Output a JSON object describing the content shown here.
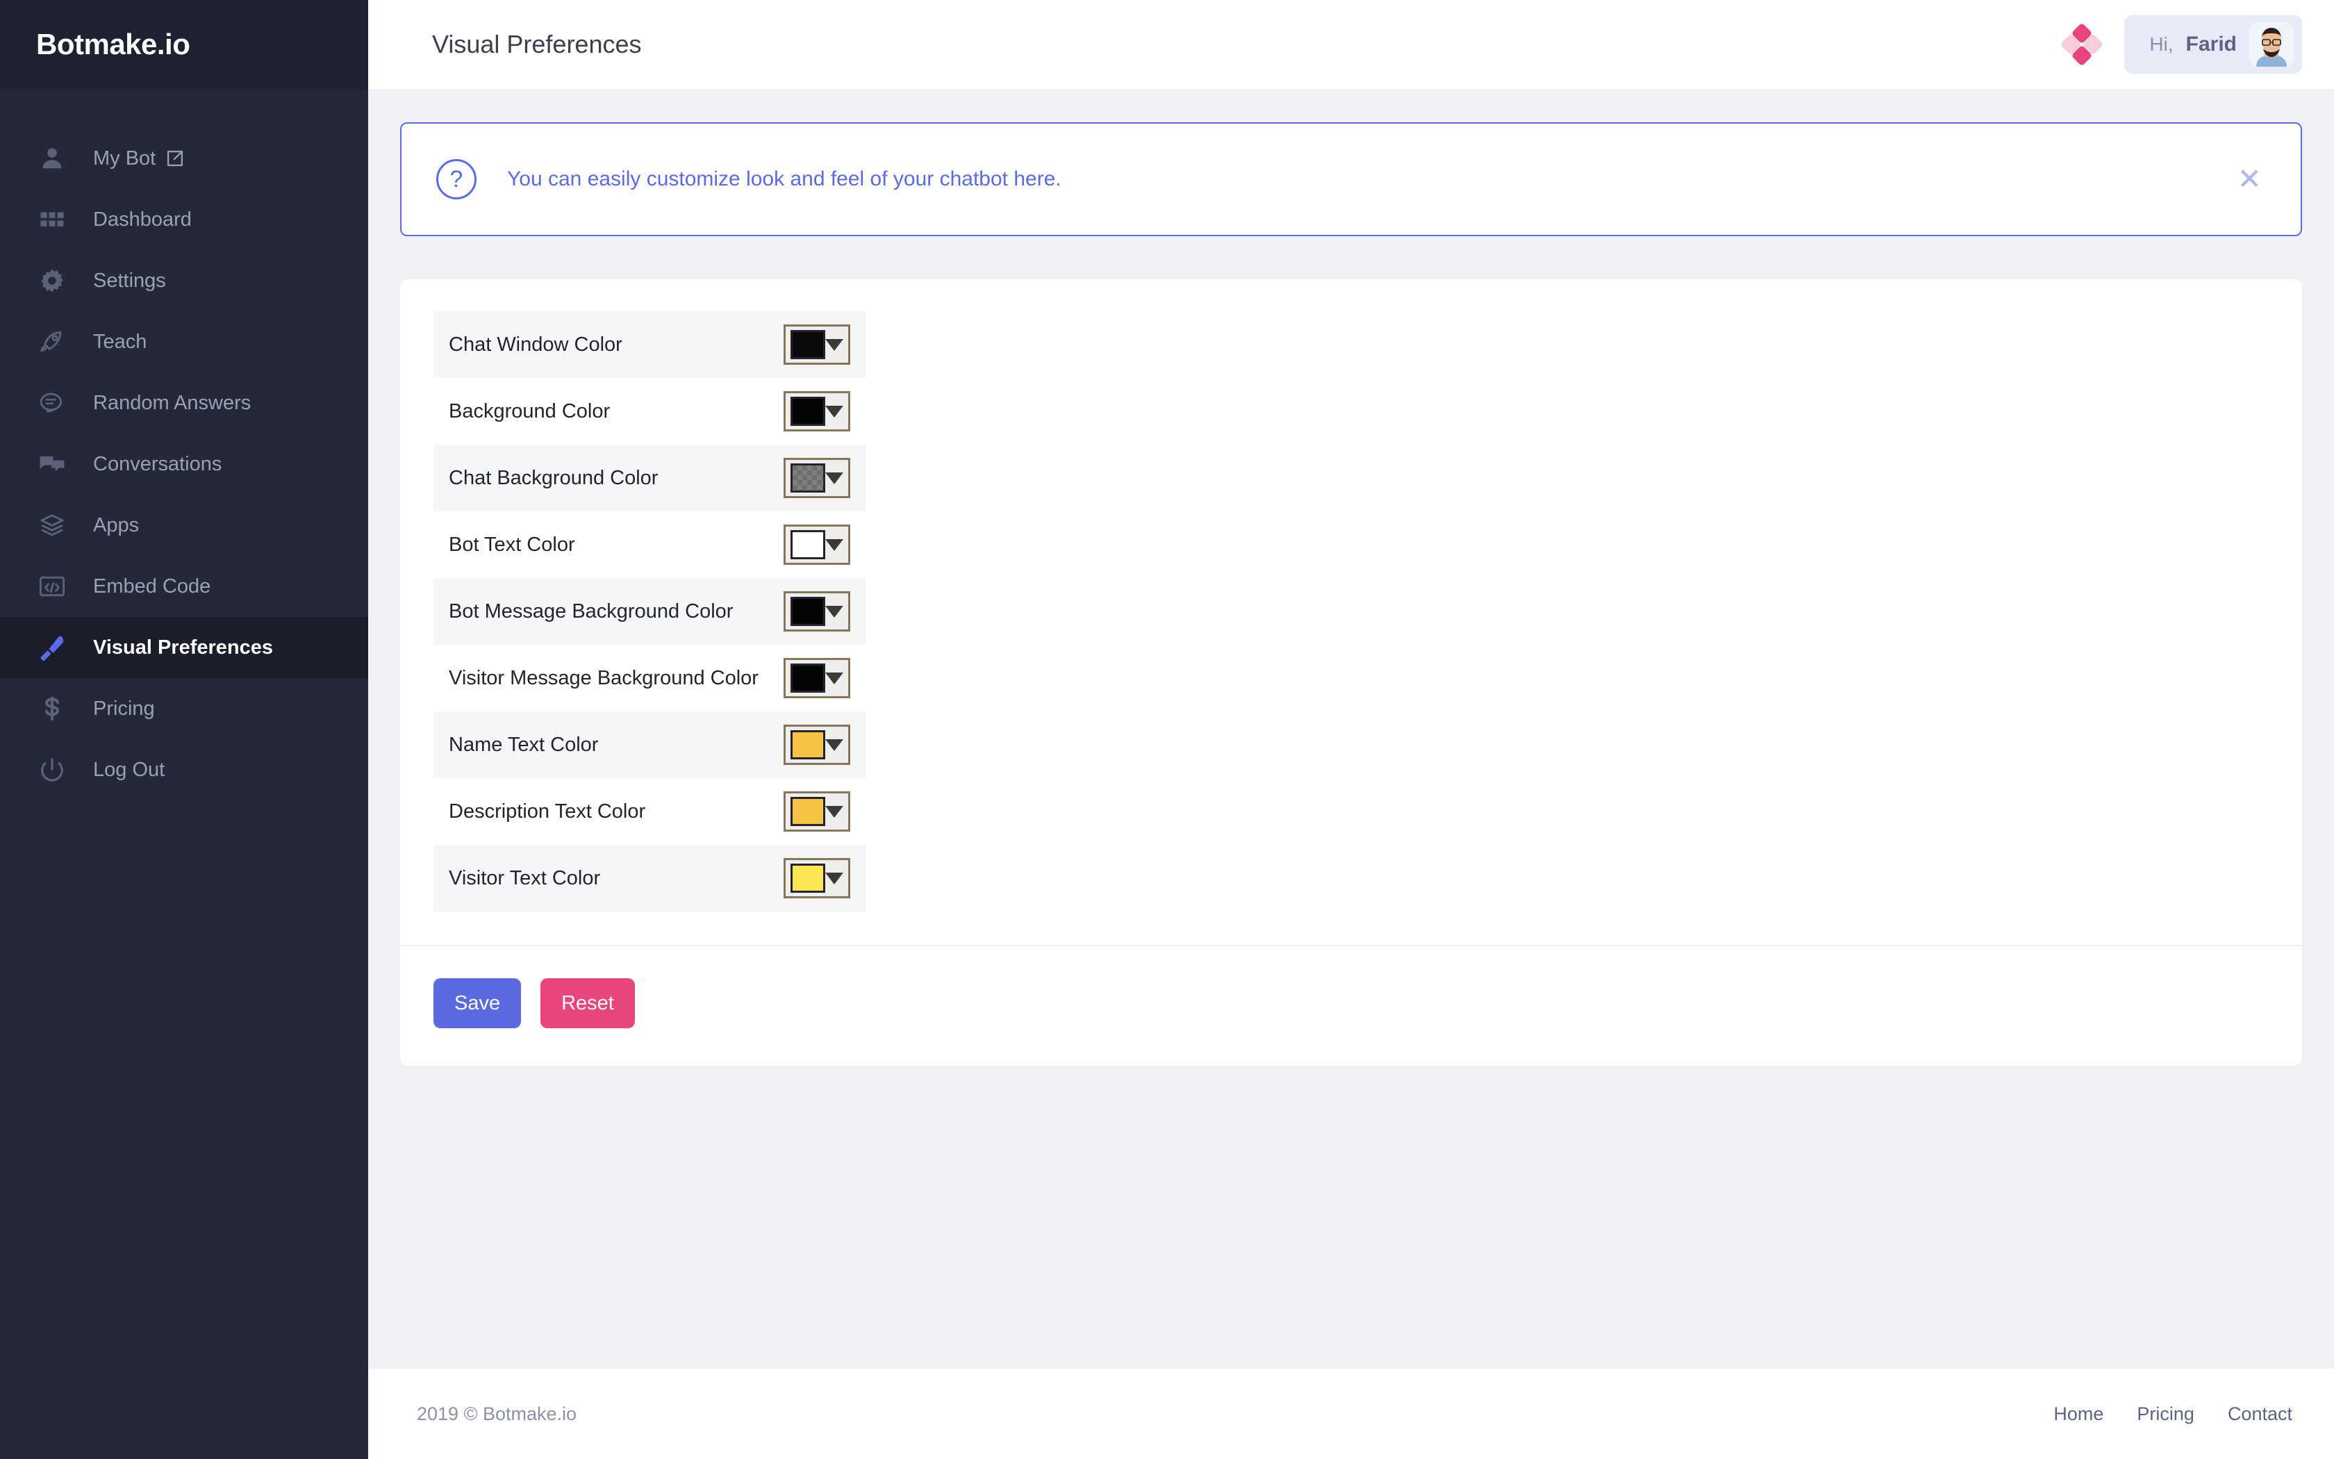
{
  "brand": {
    "name": "Botmake.io"
  },
  "sidebar": {
    "items": [
      {
        "label": "My Bot",
        "icon": "user-icon",
        "external": true,
        "active": false
      },
      {
        "label": "Dashboard",
        "icon": "grid-icon",
        "external": false,
        "active": false
      },
      {
        "label": "Settings",
        "icon": "gear-icon",
        "external": false,
        "active": false
      },
      {
        "label": "Teach",
        "icon": "rocket-icon",
        "external": false,
        "active": false
      },
      {
        "label": "Random Answers",
        "icon": "chat-bubbles-icon",
        "external": false,
        "active": false
      },
      {
        "label": "Conversations",
        "icon": "conversations-icon",
        "external": false,
        "active": false
      },
      {
        "label": "Apps",
        "icon": "layers-icon",
        "external": false,
        "active": false
      },
      {
        "label": "Embed Code",
        "icon": "code-icon",
        "external": false,
        "active": false
      },
      {
        "label": "Visual Preferences",
        "icon": "paintbrush-icon",
        "external": false,
        "active": true
      },
      {
        "label": "Pricing",
        "icon": "dollar-icon",
        "external": false,
        "active": false
      },
      {
        "label": "Log Out",
        "icon": "power-icon",
        "external": false,
        "active": false
      }
    ]
  },
  "header": {
    "title": "Visual Preferences",
    "logo_icon": "diamond-logo-icon",
    "greeting": "Hi,",
    "username": "Farid",
    "avatar_icon": "user-avatar"
  },
  "banner": {
    "icon": "question-mark-icon",
    "message": "You can easily customize look and feel of your chatbot here.",
    "close_icon": "close-icon",
    "accent_color": "#5b6ae8"
  },
  "preferences": {
    "rows": [
      {
        "label": "Chat Window Color",
        "color": "#0a0a0a",
        "transparent": false
      },
      {
        "label": "Background Color",
        "color": "#050505",
        "transparent": false
      },
      {
        "label": "Chat Background Color",
        "color": "#6b6b6b",
        "transparent": true
      },
      {
        "label": "Bot Text Color",
        "color": "#ffffff",
        "transparent": false
      },
      {
        "label": "Bot Message Background Color",
        "color": "#050505",
        "transparent": false
      },
      {
        "label": "Visitor Message Background Color",
        "color": "#050505",
        "transparent": false
      },
      {
        "label": "Name Text Color",
        "color": "#f5c242",
        "transparent": false
      },
      {
        "label": "Description Text Color",
        "color": "#f5c242",
        "transparent": false
      },
      {
        "label": "Visitor Text Color",
        "color": "#fce552",
        "transparent": false
      }
    ]
  },
  "actions": {
    "save_label": "Save",
    "reset_label": "Reset",
    "save_color": "#5b6ae0",
    "reset_color": "#e8457a"
  },
  "footer": {
    "copyright": "2019 © Botmake.io",
    "links": [
      {
        "label": "Home"
      },
      {
        "label": "Pricing"
      },
      {
        "label": "Contact"
      }
    ]
  }
}
